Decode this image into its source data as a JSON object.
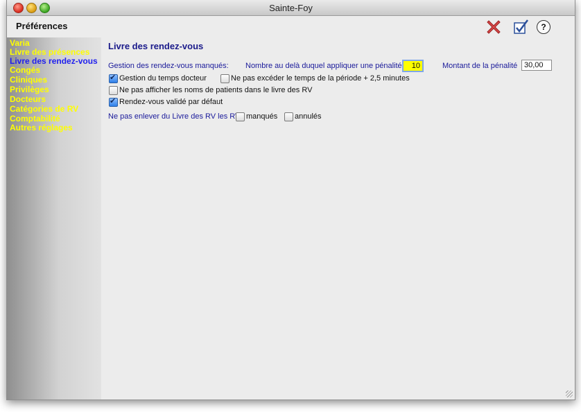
{
  "window": {
    "title": "Sainte-Foy"
  },
  "header": {
    "title": "Préférences",
    "help_glyph": "?"
  },
  "icons": {
    "cancel": "red-x-icon",
    "validate": "checkbox-check-icon",
    "help": "question-icon"
  },
  "colors": {
    "sidebar_text": "#ffff00",
    "sidebar_active": "#2020ee",
    "label_blue": "#1a1a9a",
    "focused_field": "#ffff00"
  },
  "sidebar": {
    "items": [
      {
        "label": "Varia"
      },
      {
        "label": "Livre des présences"
      },
      {
        "label": "Livre des rendez-vous",
        "active": true
      },
      {
        "label": "Congés"
      },
      {
        "label": "Cliniques"
      },
      {
        "label": "Privilèges"
      },
      {
        "label": "Docteurs"
      },
      {
        "label": "Catégories de RV"
      },
      {
        "label": "Comptabilité"
      },
      {
        "label": "Autres réglages"
      }
    ]
  },
  "main": {
    "section_title": "Livre des rendez-vous",
    "missed_label": "Gestion des rendez-vous manqués:",
    "penalty_threshold_label": "Nombre au delà duquel appliquer une pénalité",
    "penalty_threshold_value": "10",
    "penalty_amount_label": "Montant de la pénalité",
    "penalty_amount_value": "30,00",
    "options": {
      "doctor_time": {
        "label": "Gestion du temps docteur",
        "checked": true
      },
      "no_exceed": {
        "label": "Ne pas excéder le temps de la période + 2,5 minutes",
        "checked": false
      },
      "hide_names": {
        "label": "Ne pas afficher les noms de patients dans le livre des RV",
        "checked": false
      },
      "validated_default": {
        "label": "Rendez-vous validé par défaut",
        "checked": true
      }
    },
    "keep_label": "Ne pas enlever du Livre des RV les RV",
    "keep_missed": {
      "label": "manqués",
      "checked": false
    },
    "keep_cancelled": {
      "label": "annulés",
      "checked": false
    }
  }
}
